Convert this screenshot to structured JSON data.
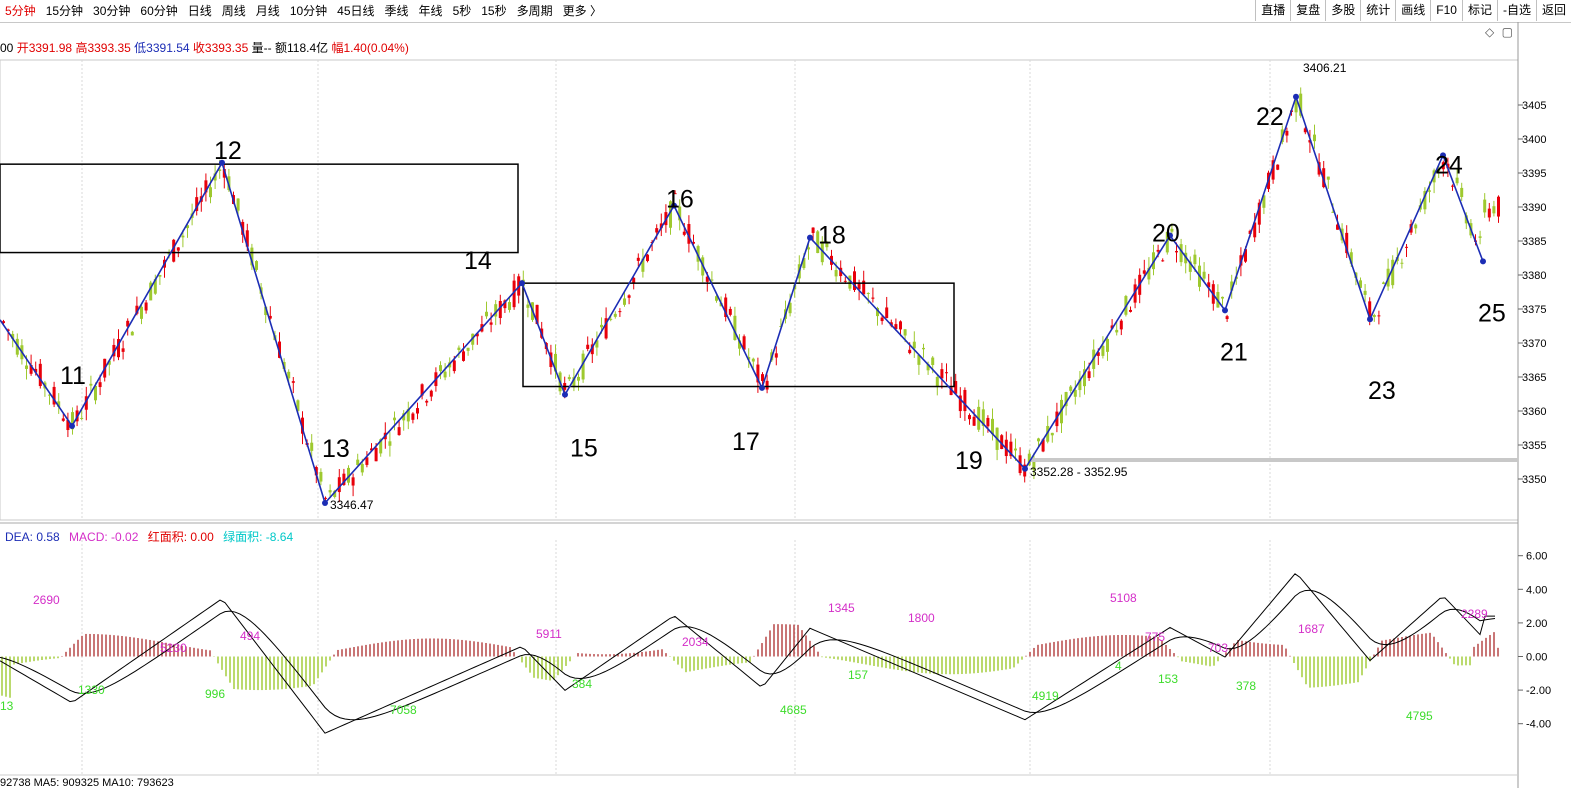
{
  "toolbar": {
    "periods": [
      "5分钟",
      "15分钟",
      "30分钟",
      "60分钟",
      "日线",
      "周线",
      "月线",
      "10分钟",
      "45日线",
      "季线",
      "年线",
      "5秒",
      "15秒",
      "多周期",
      "更多 〉"
    ],
    "active_index": 0,
    "tools": [
      "直播",
      "复盘",
      "多股",
      "统计",
      "画线",
      "F10",
      "标记",
      "-自选",
      "返回"
    ]
  },
  "ohlc": {
    "prefix": "00",
    "open": "开3391.98",
    "high": "高3393.35",
    "low": "低3391.54",
    "close": "收3393.35",
    "volume": "量--",
    "amount": "额118.4亿",
    "range": "幅1.40(0.04%)"
  },
  "controls": {
    "diamond": "◇",
    "square": "▢"
  },
  "macd_legend": {
    "dea": "DEA: 0.58",
    "macd": "MACD: -0.02",
    "red_area": "红面积: 0.00",
    "green_area": "绿面积: -8.64"
  },
  "ma_line": "92738 MA5: 909325 MA10: 793623",
  "colors": {
    "up": "#e8000a",
    "down": "#9ec92f",
    "zigzag": "#1c2db5",
    "magenta": "#d42ec8",
    "green_label": "#3ddc2b"
  },
  "chart_data": {
    "type": "candlestick",
    "price_axis": {
      "min": 3350,
      "max": 3405,
      "ticks": [
        3350,
        3355,
        3360,
        3365,
        3370,
        3375,
        3380,
        3385,
        3390,
        3395,
        3400,
        3405
      ]
    },
    "macd_axis": {
      "ticks": [
        "6.00",
        "4.00",
        "2.00",
        "0.00",
        "-2.00",
        "-4.00"
      ]
    },
    "wave_points": [
      {
        "label": "11",
        "price": 3357.8
      },
      {
        "label": "12",
        "price": 3396.5
      },
      {
        "label": "13",
        "price": 3346.47
      },
      {
        "label": "14",
        "price": 3378.8
      },
      {
        "label": "15",
        "price": 3362.4
      },
      {
        "label": "16",
        "price": 3390.2
      },
      {
        "label": "17",
        "price": 3363.4
      },
      {
        "label": "18",
        "price": 3385.5
      },
      {
        "label": "19",
        "price": 3351.5
      },
      {
        "label": "20",
        "price": 3385.8
      },
      {
        "label": "21",
        "price": 3374.8
      },
      {
        "label": "22",
        "price": 3406.21
      },
      {
        "label": "23",
        "price": 3373.5
      },
      {
        "label": "24",
        "price": 3397.6
      },
      {
        "label": "25",
        "price": 3382.0
      }
    ],
    "annotations": {
      "low_13": "3346.47",
      "low_19": "3352.28 - 3352.95",
      "high_22": "3406.21"
    },
    "boxes": [
      {
        "price_top": 3396.3,
        "price_bottom": 3383.3
      },
      {
        "price_top": 3378.8,
        "price_bottom": 3363.6
      }
    ],
    "support_line_price": 3352.8,
    "macd_labels": [
      {
        "text": "2690",
        "color": "magenta"
      },
      {
        "text": "1330",
        "color": "green"
      },
      {
        "text": "5230",
        "color": "magenta"
      },
      {
        "text": "996",
        "color": "green"
      },
      {
        "text": "494",
        "color": "magenta"
      },
      {
        "text": "7058",
        "color": "green"
      },
      {
        "text": "5911",
        "color": "magenta"
      },
      {
        "text": "384",
        "color": "green"
      },
      {
        "text": "2034",
        "color": "magenta"
      },
      {
        "text": "4685",
        "color": "green"
      },
      {
        "text": "1345",
        "color": "magenta"
      },
      {
        "text": "157",
        "color": "green"
      },
      {
        "text": "1800",
        "color": "magenta"
      },
      {
        "text": "4919",
        "color": "green"
      },
      {
        "text": "5108",
        "color": "magenta"
      },
      {
        "text": "4",
        "color": "green"
      },
      {
        "text": "775",
        "color": "magenta"
      },
      {
        "text": "153",
        "color": "green"
      },
      {
        "text": "703",
        "color": "magenta"
      },
      {
        "text": "378",
        "color": "green"
      },
      {
        "text": "1687",
        "color": "magenta"
      },
      {
        "text": "4795",
        "color": "green"
      },
      {
        "text": "2289",
        "color": "magenta"
      },
      {
        "text": "13",
        "color": "green"
      }
    ]
  }
}
